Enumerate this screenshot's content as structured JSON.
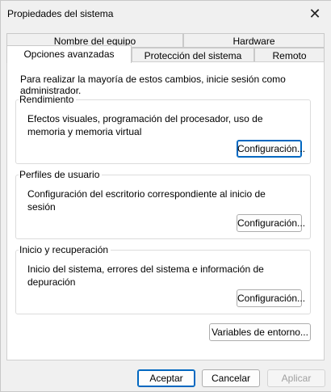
{
  "window": {
    "title": "Propiedades del sistema",
    "close_glyph": "✕"
  },
  "tabs": {
    "row1": [
      {
        "label": "Nombre del equipo"
      },
      {
        "label": "Hardware"
      }
    ],
    "row2": [
      {
        "label": "Opciones avanzadas",
        "active": true
      },
      {
        "label": "Protección del sistema"
      },
      {
        "label": "Remoto"
      }
    ]
  },
  "panel": {
    "note": "Para realizar la mayoría de estos cambios, inicie sesión como administrador.",
    "groups": [
      {
        "title": "Rendimiento",
        "description": "Efectos visuales, programación del procesador, uso de memoria y memoria virtual",
        "button": "Configuración..."
      },
      {
        "title": "Perfiles de usuario",
        "description": "Configuración del escritorio correspondiente al inicio de sesión",
        "button": "Configuración..."
      },
      {
        "title": "Inicio y recuperación",
        "description": "Inicio del sistema, errores del sistema e información de depuración",
        "button": "Configuración..."
      }
    ],
    "env_button": "Variables de entorno..."
  },
  "footer": {
    "ok": "Aceptar",
    "cancel": "Cancelar",
    "apply": "Aplicar"
  },
  "colors": {
    "primary_border": "#0067c0"
  }
}
